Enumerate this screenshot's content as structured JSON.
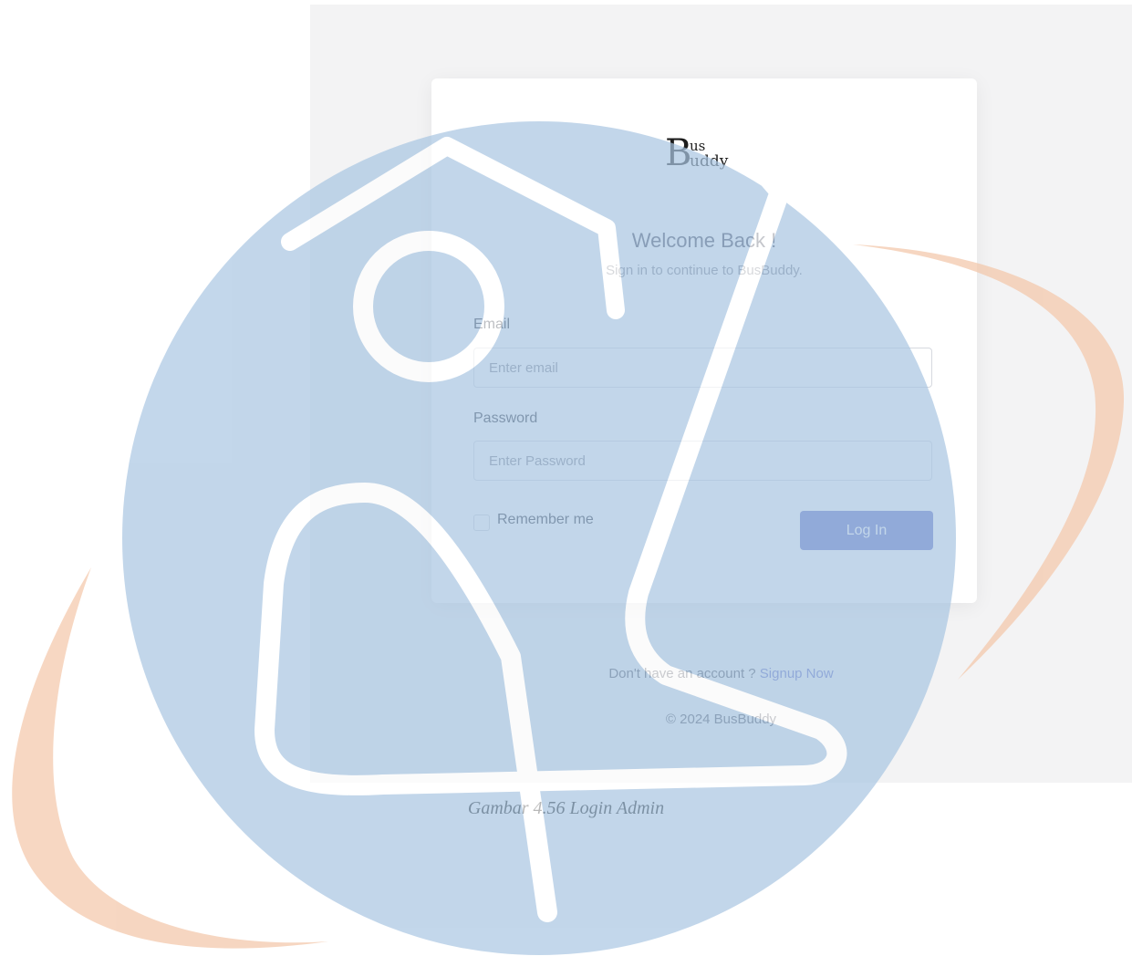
{
  "logo": {
    "b": "B",
    "us": "us",
    "uddy": "uddy"
  },
  "heading": "Welcome Back !",
  "subtitle": "Sign in to continue to BusBuddy.",
  "email": {
    "label": "Email",
    "placeholder": "Enter email"
  },
  "password": {
    "label": "Password",
    "placeholder": "Enter Password"
  },
  "remember_label": "Remember me",
  "login_button": "Log In",
  "signup_prompt": "Don't have an account ?",
  "signup_link": "Signup Now",
  "copyright": "© 2024 BusBuddy",
  "caption": "Gambar 4.56 Login Admin",
  "colors": {
    "accent": "#5b68c4",
    "page_bg": "#f3f3f4",
    "watermark_blue": "#a9c6e2",
    "watermark_orange": "#f3c6a8"
  }
}
